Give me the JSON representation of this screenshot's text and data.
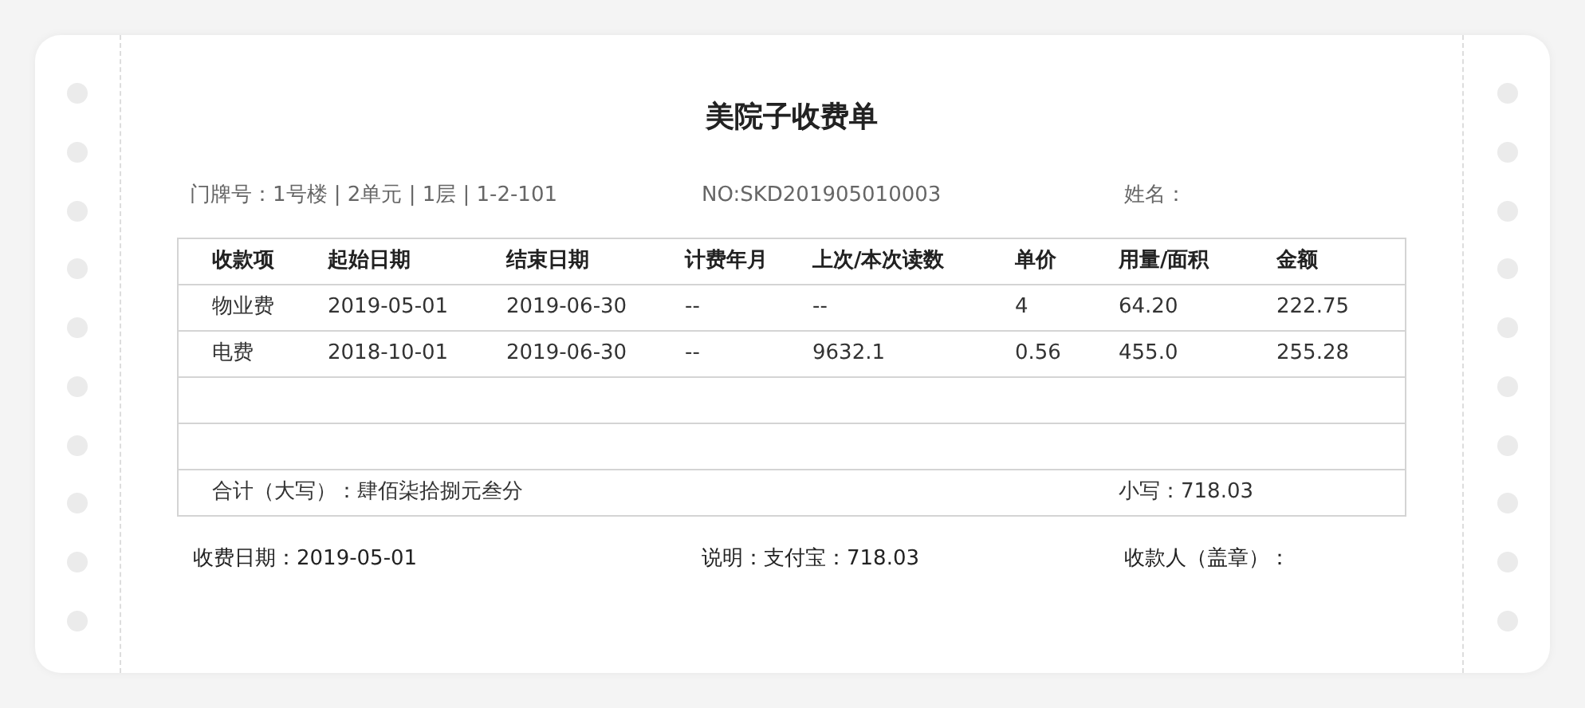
{
  "title": "美院子收费单",
  "info": [
    {
      "text": "门牌号：1号楼 | 2单元 | 1层 | 1-2-101"
    },
    {
      "text": "NO:SKD201905010003"
    },
    {
      "text": "姓名："
    }
  ],
  "table": {
    "columns": [
      "收款项",
      "起始日期",
      "结束日期",
      "计费年月",
      "上次/本次读数",
      "单价",
      "用量/面积",
      "金额"
    ],
    "rows": [
      {
        "kind": "data",
        "cells": [
          "物业费",
          "2019-05-01",
          "2019-06-30",
          "--",
          "--",
          "4",
          "64.20",
          "222.75"
        ]
      },
      {
        "kind": "data",
        "cells": [
          "电费",
          "2018-10-01",
          "2019-06-30",
          "--",
          "9632.1",
          "0.56",
          "455.0",
          "255.28"
        ]
      },
      {
        "kind": "empty"
      },
      {
        "kind": "empty"
      }
    ],
    "total_words": "合计（大写）：肆佰柒拾捌元叁分",
    "total_figures": "小写：718.03"
  },
  "footer": [
    {
      "text": "收费日期：2019-05-01"
    },
    {
      "text": "说明：支付宝：718.03"
    },
    {
      "text": "收款人（盖章）："
    }
  ]
}
